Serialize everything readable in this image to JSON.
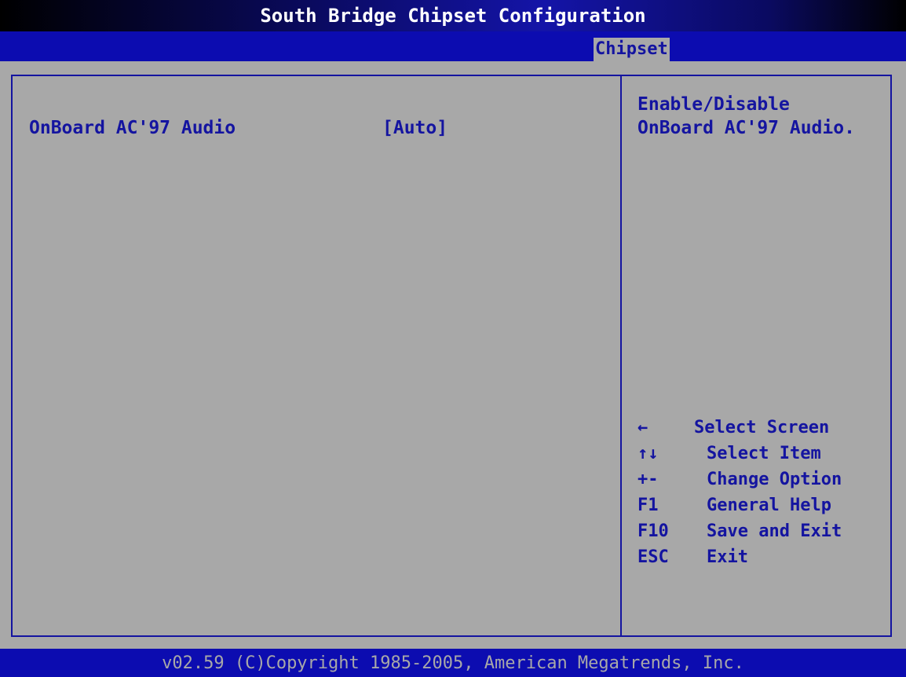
{
  "header": {
    "title": "South Bridge Chipset Configuration",
    "active_tab": "Chipset"
  },
  "settings": [
    {
      "label": "OnBoard AC'97 Audio",
      "value": "[Auto]"
    }
  ],
  "help": {
    "lines": [
      "Enable/Disable",
      "OnBoard AC'97 Audio."
    ]
  },
  "keys": [
    {
      "key": "←",
      "action": "Select Screen",
      "icon": "left-arrow-icon"
    },
    {
      "key": "↑↓",
      "action": "Select Item",
      "icon": "up-down-arrow-icon"
    },
    {
      "key": "+-",
      "action": "Change Option",
      "icon": "plus-minus-icon"
    },
    {
      "key": "F1",
      "action": "General Help"
    },
    {
      "key": "F10",
      "action": "Save and Exit"
    },
    {
      "key": "ESC",
      "action": "Exit"
    }
  ],
  "footer": {
    "text": "v02.59 (C)Copyright 1985-2005, American Megatrends, Inc."
  },
  "colors": {
    "background": "#a8a8a8",
    "text": "#1414a0",
    "bar": "#0c0cb0",
    "title_text": "#ffffff"
  }
}
